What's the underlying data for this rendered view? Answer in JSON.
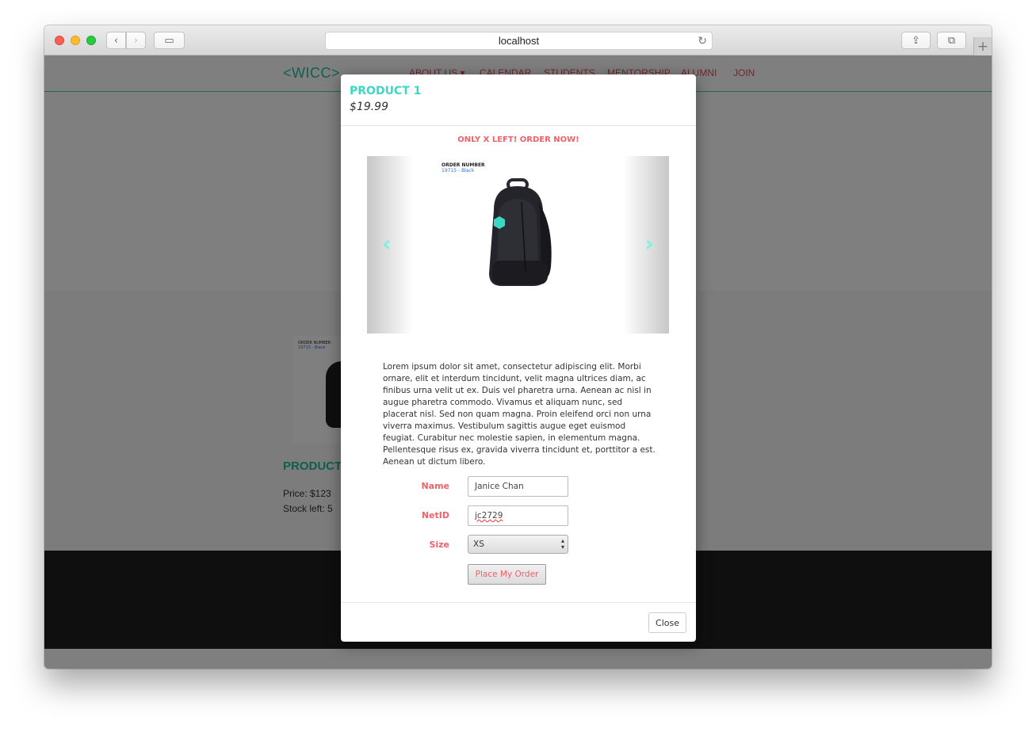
{
  "browser": {
    "url": "localhost",
    "back_icon": "‹",
    "forward_icon": "›",
    "sidebar_icon": "▭",
    "reload_icon": "↻",
    "share_icon": "⇪",
    "tabs_icon": "⧉",
    "newtab_icon": "+"
  },
  "site": {
    "logo": "<WICC>",
    "nav": [
      "ABOUT US ▾",
      "CALENDAR",
      "STUDENTS",
      "MENTORSHIP",
      "ALUMNI",
      "JOIN"
    ],
    "card": {
      "image_order_label": "ORDER NUMBER",
      "image_order_value": "19715 - Black",
      "title": "PRODUCT 1",
      "price": "Price: $123",
      "stock": "Stock left: 5"
    }
  },
  "modal": {
    "title": "PRODUCT 1",
    "price": "$19.99",
    "urgency": "ONLY X LEFT! ORDER NOW!",
    "carousel": {
      "order_label": "ORDER NUMBER",
      "order_value": "19715 - Black",
      "prev_icon": "‹",
      "next_icon": "›"
    },
    "description": "Lorem ipsum dolor sit amet, consectetur adipiscing elit. Morbi ornare, elit et interdum tincidunt, velit magna ultrices diam, ac finibus urna velit ut ex. Duis vel pharetra urna. Aenean ac nisl in augue pharetra commodo. Vivamus et aliquam nunc, sed placerat nisl. Sed non quam magna. Proin eleifend orci non urna viverra maximus. Vestibulum sagittis augue eget euismod feugiat. Curabitur nec molestie sapien, in elementum magna. Pellentesque risus ex, gravida viverra tincidunt et, porttitor a est. Aenean ut dictum libero.",
    "form": {
      "name_label": "Name",
      "name_value": "Janice Chan",
      "netid_label": "NetID",
      "netid_value": "jc2729",
      "size_label": "Size",
      "size_value": "XS",
      "submit_label": "Place My Order"
    },
    "close_label": "Close"
  },
  "colors": {
    "accent": "#3ed7c4",
    "alert": "#f0616a",
    "nav_link": "#e34a5a"
  }
}
